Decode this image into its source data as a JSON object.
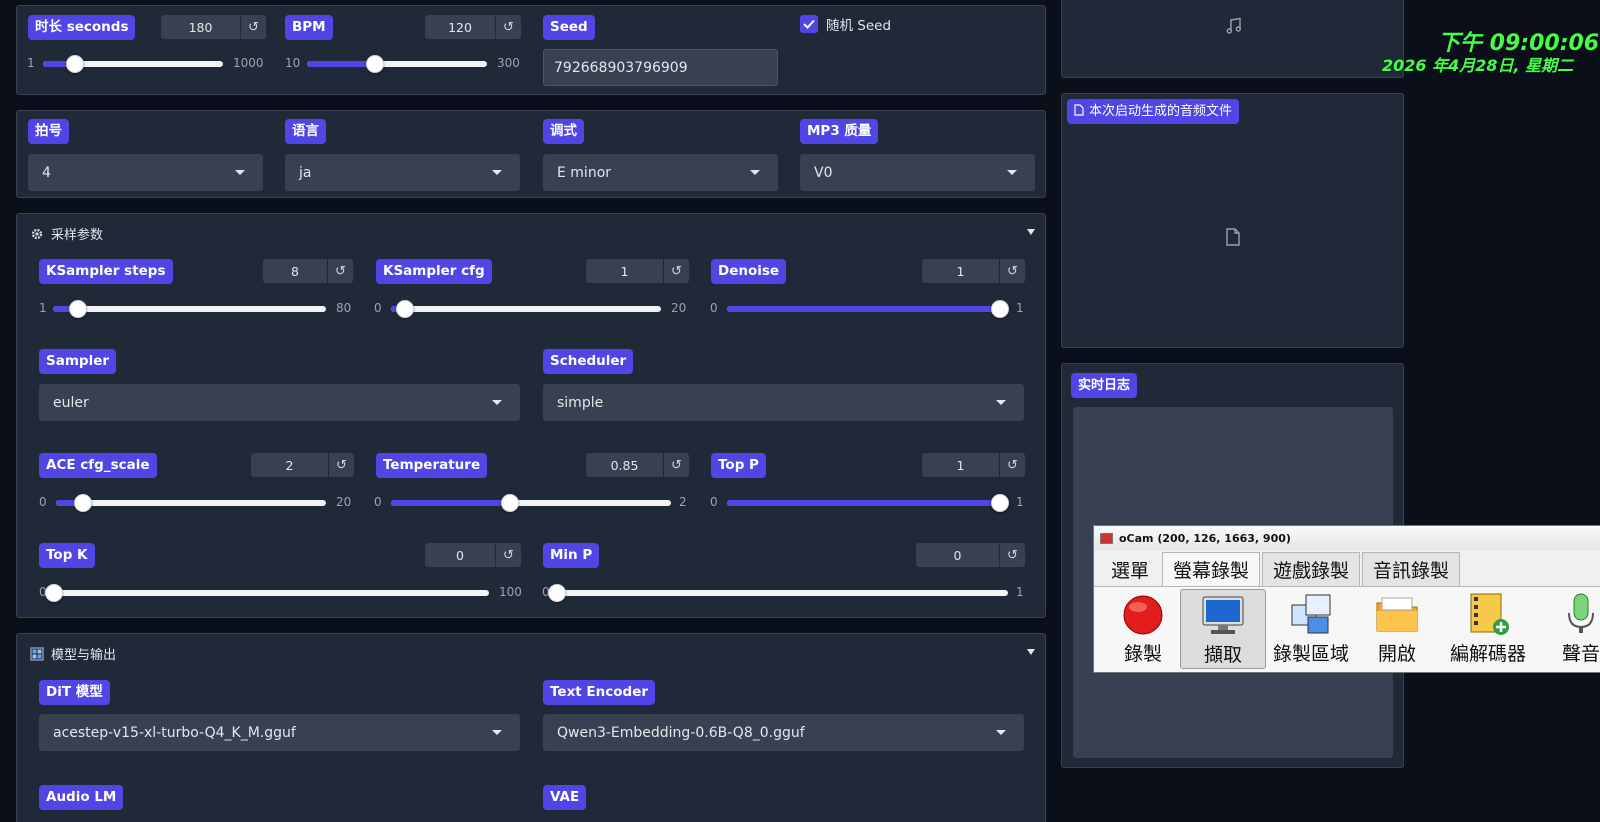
{
  "row1": {
    "duration": {
      "label": "时长 seconds",
      "value": "180",
      "min": "1",
      "max": "1000",
      "frac": 0.18
    },
    "bpm": {
      "label": "BPM",
      "value": "120",
      "min": "10",
      "max": "300",
      "frac": 0.38
    },
    "seed": {
      "label": "Seed",
      "value": "792668903796909"
    },
    "random_seed": {
      "label": "随机 Seed",
      "checked": true
    }
  },
  "row2": {
    "beat": {
      "label": "拍号",
      "value": "4"
    },
    "language": {
      "label": "语言",
      "value": "ja"
    },
    "key": {
      "label": "调式",
      "value": "E minor"
    },
    "mp3": {
      "label": "MP3 质量",
      "value": "V0"
    }
  },
  "sampling": {
    "title": "采样参数",
    "steps": {
      "label": "KSampler steps",
      "value": "8",
      "min": "1",
      "max": "80",
      "frac": 0.09
    },
    "cfg": {
      "label": "KSampler cfg",
      "value": "1",
      "min": "0",
      "max": "20",
      "frac": 0.05
    },
    "denoise": {
      "label": "Denoise",
      "value": "1",
      "min": "0",
      "max": "1",
      "frac": 1.0
    },
    "sampler": {
      "label": "Sampler",
      "value": "euler"
    },
    "scheduler": {
      "label": "Scheduler",
      "value": "simple"
    },
    "ace_cfg": {
      "label": "ACE cfg_scale",
      "value": "2",
      "min": "0",
      "max": "20",
      "frac": 0.1
    },
    "temperature": {
      "label": "Temperature",
      "value": "0.85",
      "min": "0",
      "max": "2",
      "frac": 0.425
    },
    "top_p": {
      "label": "Top P",
      "value": "1",
      "min": "0",
      "max": "1",
      "frac": 1.0
    },
    "top_k": {
      "label": "Top K",
      "value": "0",
      "min": "0",
      "max": "100",
      "frac": 0.0
    },
    "min_p": {
      "label": "Min P",
      "value": "0",
      "min": "0",
      "max": "1",
      "frac": 0.0
    }
  },
  "model": {
    "title": "模型与输出",
    "dit": {
      "label": "DiT 模型",
      "value": "acestep-v15-xl-turbo-Q4_K_M.gguf"
    },
    "text_encoder": {
      "label": "Text Encoder",
      "value": "Qwen3-Embedding-0.6B-Q8_0.gguf"
    },
    "audio_lm": {
      "label": "Audio LM"
    },
    "vae": {
      "label": "VAE"
    }
  },
  "right": {
    "files_label": "本次启动生成的音频文件",
    "log_label": "实时日志"
  },
  "clock": {
    "time": "下午 09:00:06",
    "date": "2026 年4月28日, 星期二"
  },
  "ocam": {
    "title": "oCam (200, 126, 1663, 900)",
    "tabs": [
      "選單",
      "螢幕錄製",
      "遊戲錄製",
      "音訊錄製"
    ],
    "tools": [
      "錄製",
      "擷取",
      "錄製區域",
      "開啟",
      "編解碼器",
      "聲音"
    ]
  },
  "colors": {
    "accent": "#4f46e5",
    "panel": "#1f2937",
    "clock": "#44ff44"
  }
}
